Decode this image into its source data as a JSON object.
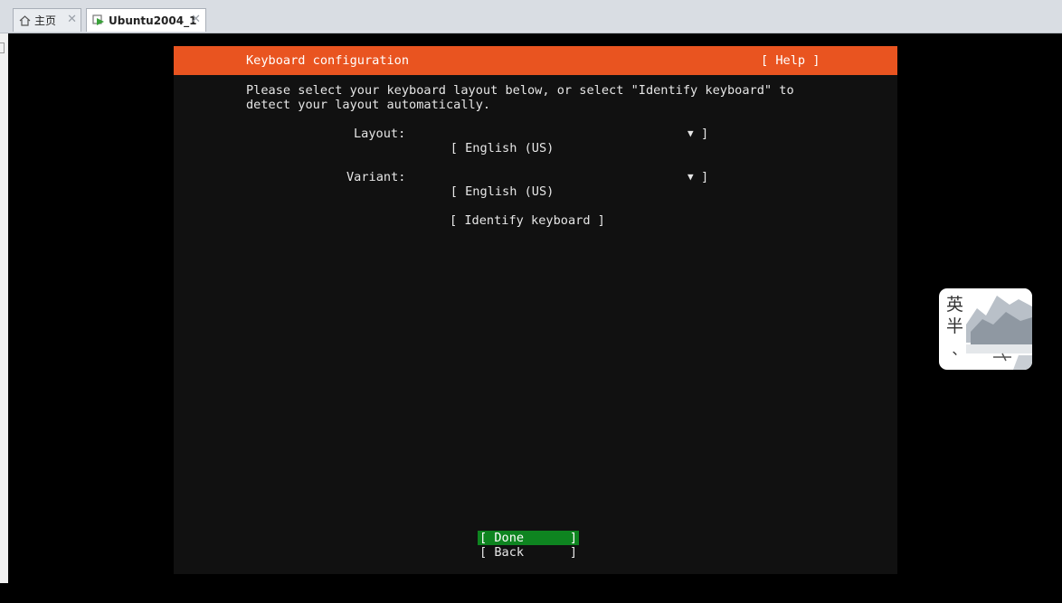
{
  "tabs": [
    {
      "label": "主页",
      "icon": "home-icon"
    },
    {
      "label": "Ubuntu2004_1",
      "icon": "vm-icon",
      "active": true
    }
  ],
  "installer": {
    "header_title": "Keyboard configuration",
    "help_label": "[ Help ]",
    "description_line1": "Please select your keyboard layout below, or select \"Identify keyboard\" to",
    "description_line2": "detect your layout automatically.",
    "layout_label": "Layout:",
    "layout_value": "[ English (US)",
    "variant_label": "Variant:",
    "variant_value": "[ English (US)",
    "dropdown_arrow": "▼",
    "bracket_close": "]",
    "identify_button": "[ Identify keyboard ]",
    "done_button": "[ Done",
    "back_button": "[ Back",
    "colors": {
      "header": "#e95420",
      "done_bg": "#0e8420",
      "background": "#111111"
    }
  },
  "widget": {
    "chars": "英\n半\n﹑"
  }
}
